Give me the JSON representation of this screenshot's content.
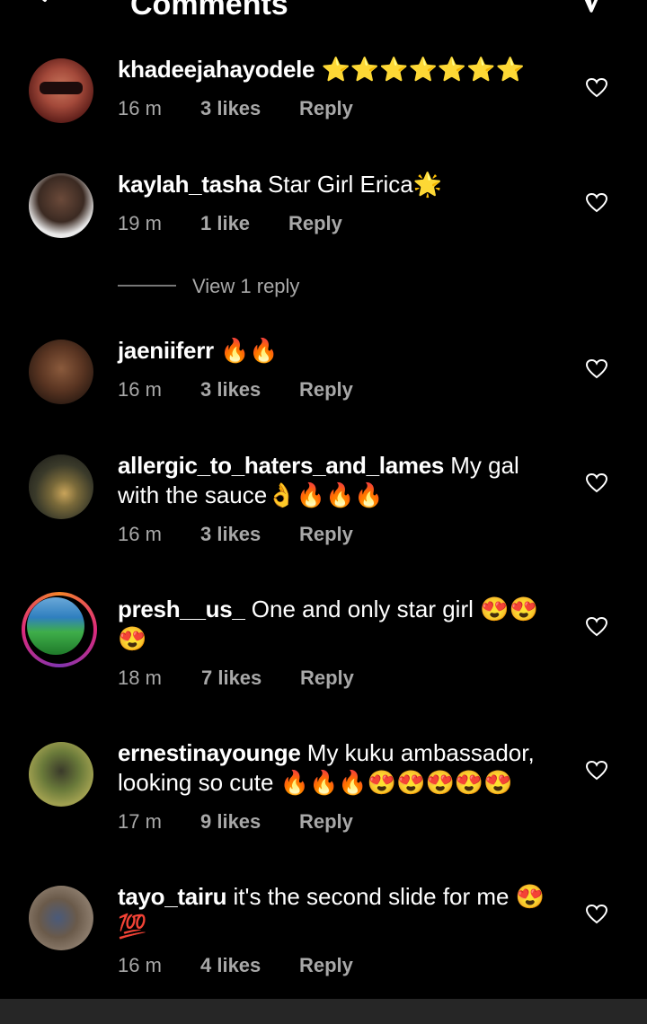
{
  "header": {
    "title": "Comments",
    "back_icon": "arrow-left-icon",
    "send_icon": "send-icon"
  },
  "comments": [
    {
      "username": "khadeejahayodele",
      "text": "⭐⭐⭐⭐⭐⭐⭐",
      "time": "16 m",
      "likes": "3 likes",
      "reply": "Reply"
    },
    {
      "username": "kaylah_tasha",
      "text": "Star Girl Erica🌟",
      "time": "19 m",
      "likes": "1 like",
      "reply": "Reply",
      "view_replies": "View 1 reply"
    },
    {
      "username": "jaeniiferr",
      "text": "🔥🔥",
      "time": "16 m",
      "likes": "3 likes",
      "reply": "Reply"
    },
    {
      "username": "allergic_to_haters_and_lames",
      "text": "My gal with the sauce👌🔥🔥🔥",
      "time": "16 m",
      "likes": "3 likes",
      "reply": "Reply"
    },
    {
      "username": "presh__us_",
      "text": "One and only star girl 😍😍😍",
      "time": "18 m",
      "likes": "7 likes",
      "reply": "Reply"
    },
    {
      "username": "ernestinayounge",
      "text": "My kuku ambassador, looking so cute 🔥🔥🔥😍😍😍😍😍",
      "time": "17 m",
      "likes": "9 likes",
      "reply": "Reply"
    },
    {
      "username": "tayo_tairu",
      "text": "it's the second slide for me 😍💯",
      "time": "16 m",
      "likes": "4 likes",
      "reply": "Reply"
    }
  ],
  "colors": {
    "background": "#000000",
    "secondary_text": "#a8a8a8",
    "story_ring": "#dd2a7b"
  }
}
